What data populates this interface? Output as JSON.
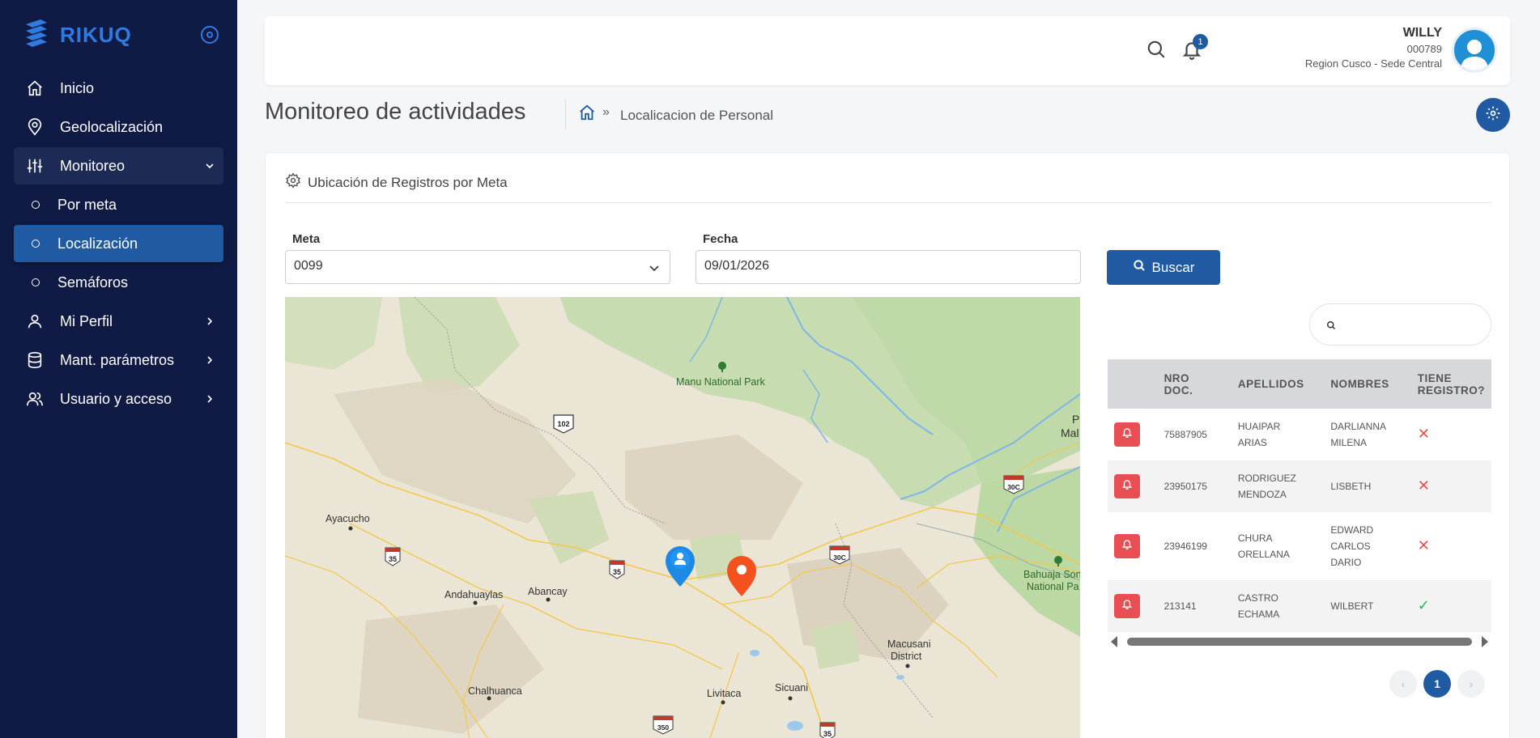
{
  "app": {
    "name": "RIKUQ"
  },
  "sidebar": {
    "items": [
      {
        "label": "Inicio",
        "icon": "home-icon"
      },
      {
        "label": "Geolocalización",
        "icon": "map-pin-icon"
      },
      {
        "label": "Monitoreo",
        "icon": "sliders-icon",
        "expanded": true
      },
      {
        "label": "Por meta"
      },
      {
        "label": "Localización",
        "active": true
      },
      {
        "label": "Semáforos"
      },
      {
        "label": "Mi Perfil",
        "icon": "user-icon"
      },
      {
        "label": "Mant. parámetros",
        "icon": "database-icon"
      },
      {
        "label": "Usuario y acceso",
        "icon": "users-icon"
      }
    ]
  },
  "header": {
    "notifications": "1",
    "user_name": "WILLY",
    "user_code": "000789",
    "user_region": "Region Cusco - Sede Central"
  },
  "page": {
    "title": "Monitoreo de actividades",
    "breadcrumb_current": "Localicacion de Personal"
  },
  "card": {
    "title": "Ubicación de Registros por Meta",
    "meta_label": "Meta",
    "meta_value": "0099",
    "fecha_label": "Fecha",
    "fecha_value": "09/01/2026",
    "search_button": "Buscar"
  },
  "map": {
    "labels": {
      "manu": "Manu National Park",
      "ayacucho": "Ayacucho",
      "andahuaylas": "Andahuaylas",
      "abancay": "Abancay",
      "chalhuanca": "Chalhuanca",
      "livitaca": "Livitaca",
      "sicuani": "Sicuani",
      "macusani": "Macusani",
      "district": "District",
      "bahuaja1": "Bahuaja Son",
      "bahuaja2": "National Pa",
      "p": "P",
      "mal": "Mal"
    },
    "shields": [
      "102",
      "35",
      "35",
      "30C",
      "30C",
      "350",
      "35"
    ]
  },
  "table": {
    "headers": [
      {
        "l1": "NRO",
        "l2": "DOC."
      },
      {
        "l1": "APELLIDOS",
        "l2": ""
      },
      {
        "l1": "NOMBRES",
        "l2": ""
      },
      {
        "l1": "TIENE",
        "l2": "REGISTRO?"
      }
    ],
    "rows": [
      {
        "doc": "75887905",
        "ap1": "HUAIPAR",
        "ap2": "ARIAS",
        "n1": "DARLIANNA",
        "n2": "MILENA",
        "n3": "",
        "registro": false
      },
      {
        "doc": "23950175",
        "ap1": "RODRIGUEZ",
        "ap2": "MENDOZA",
        "n1": "LISBETH",
        "n2": "",
        "n3": "",
        "registro": false
      },
      {
        "doc": "23946199",
        "ap1": "CHURA",
        "ap2": "ORELLANA",
        "n1": "EDWARD",
        "n2": "CARLOS",
        "n3": "DARIO",
        "registro": false
      },
      {
        "doc": "213141",
        "ap1": "CASTRO",
        "ap2": "ECHAMA",
        "n1": "WILBERT",
        "n2": "",
        "n3": "",
        "registro": true
      }
    ],
    "pager": {
      "prev": "‹",
      "current": "1",
      "next": "›"
    }
  },
  "colors": {
    "sidebar": "#0f1b45",
    "accent": "#1f5aa3",
    "danger": "#e84e52",
    "ok": "#2db358"
  }
}
